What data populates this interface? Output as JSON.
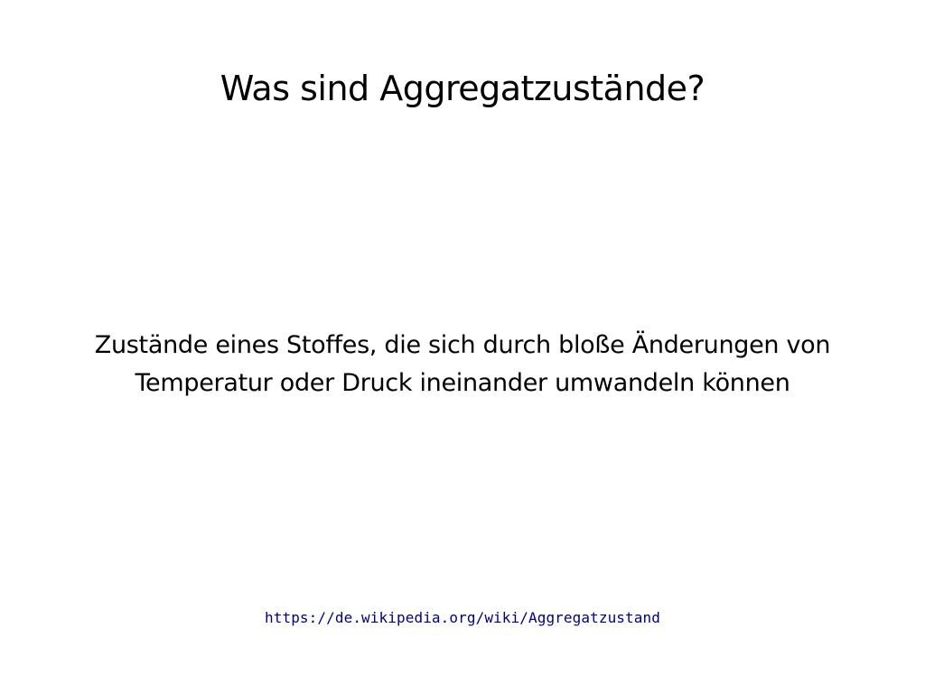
{
  "slide": {
    "title": "Was sind Aggregatzustände?",
    "body_lines": [
      "Zustände eines Stoffes, die sich durch bloße Änderungen von",
      "Temperatur oder Druck ineinander umwandeln können"
    ],
    "source_url": "https://de.wikipedia.org/wiki/Aggregatzustand"
  },
  "colors": {
    "background": "#ffffff",
    "text": "#000000",
    "link": "#000080"
  }
}
